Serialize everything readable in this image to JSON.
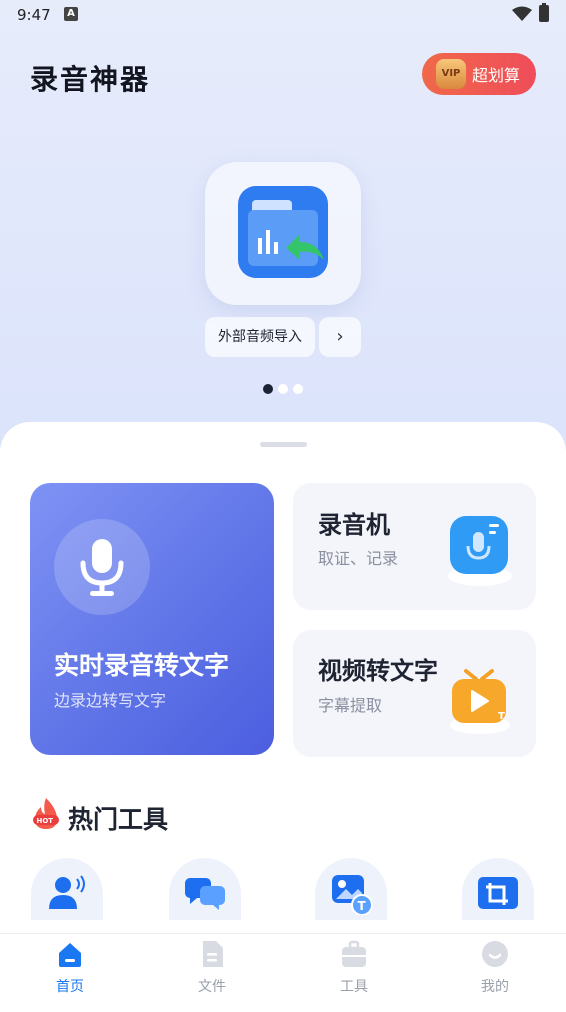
{
  "status": {
    "time": "9:47",
    "notification_icon": "A"
  },
  "header": {
    "title": "录音神器",
    "vip_badge": "VIP",
    "vip_label": "超划算"
  },
  "carousel": {
    "item_label": "外部音频导入",
    "arrow": "›",
    "page_count": 3,
    "active_page": 1
  },
  "features": {
    "realtime": {
      "title": "实时录音转文字",
      "subtitle": "边录边转写文字"
    },
    "recorder": {
      "title": "录音机",
      "subtitle": "取证、记录"
    },
    "video": {
      "title": "视频转文字",
      "subtitle": "字幕提取"
    }
  },
  "hot_tools": {
    "badge": "HOT",
    "title": "热门工具",
    "icons": [
      "voice-person-icon",
      "chat-bubbles-icon",
      "image-to-text-icon",
      "crop-icon"
    ]
  },
  "nav": {
    "items": [
      {
        "label": "首页",
        "active": true
      },
      {
        "label": "文件",
        "active": false
      },
      {
        "label": "工具",
        "active": false
      },
      {
        "label": "我的",
        "active": false
      }
    ]
  },
  "colors": {
    "accent": "#1a78f2",
    "vip": "#ef5550",
    "card_main": "#5d72e6"
  }
}
